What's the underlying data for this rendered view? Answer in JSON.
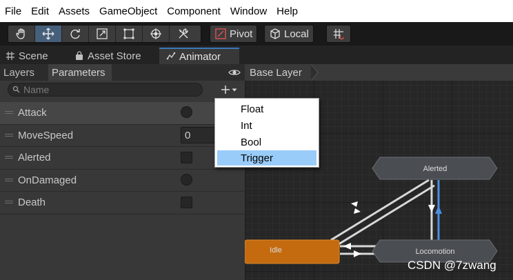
{
  "menubar": {
    "items": [
      "File",
      "Edit",
      "Assets",
      "GameObject",
      "Component",
      "Window",
      "Help"
    ]
  },
  "toolbar": {
    "tools": [
      {
        "icon": "hand-tool-icon",
        "active": false
      },
      {
        "icon": "move-tool-icon",
        "active": true
      },
      {
        "icon": "rotate-tool-icon",
        "active": false
      },
      {
        "icon": "scale-tool-icon",
        "active": false
      },
      {
        "icon": "rect-tool-icon",
        "active": false
      },
      {
        "icon": "transform-tool-icon",
        "active": false
      },
      {
        "icon": "custom-tool-icon",
        "active": false
      }
    ],
    "pivot_label": "Pivot",
    "local_label": "Local"
  },
  "tabs": [
    {
      "label": "Scene",
      "icon": "grid-icon",
      "active": false
    },
    {
      "label": "Asset Store",
      "icon": "bag-icon",
      "active": false
    },
    {
      "label": "Animator",
      "icon": "animator-icon",
      "active": true
    }
  ],
  "animator": {
    "subtabs": [
      {
        "label": "Layers",
        "active": false
      },
      {
        "label": "Parameters",
        "active": true
      }
    ],
    "search_placeholder": "Name",
    "parameters": [
      {
        "name": "Attack",
        "type": "trigger",
        "value": ""
      },
      {
        "name": "MoveSpeed",
        "type": "float",
        "value": "0"
      },
      {
        "name": "Alerted",
        "type": "bool",
        "value": ""
      },
      {
        "name": "OnDamaged",
        "type": "trigger",
        "value": ""
      },
      {
        "name": "Death",
        "type": "bool",
        "value": ""
      }
    ],
    "breadcrumb": "Base Layer",
    "add_menu": {
      "items": [
        "Float",
        "Int",
        "Bool",
        "Trigger"
      ],
      "highlighted": "Trigger"
    },
    "nodes": {
      "alerted": "Alerted",
      "idle": "Idle",
      "locomotion": "Locomotion"
    },
    "colors": {
      "idle_node": "#c46a0f",
      "state_node": "#4a4d52",
      "selected_transition": "#4a90e2"
    }
  },
  "watermark": "CSDN @7zwang"
}
